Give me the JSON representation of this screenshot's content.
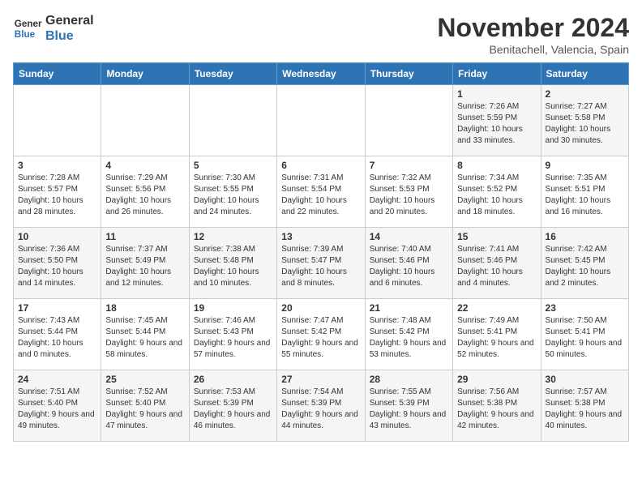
{
  "logo": {
    "line1": "General",
    "line2": "Blue"
  },
  "title": "November 2024",
  "subtitle": "Benitachell, Valencia, Spain",
  "days_of_week": [
    "Sunday",
    "Monday",
    "Tuesday",
    "Wednesday",
    "Thursday",
    "Friday",
    "Saturday"
  ],
  "weeks": [
    [
      {
        "day": "",
        "info": ""
      },
      {
        "day": "",
        "info": ""
      },
      {
        "day": "",
        "info": ""
      },
      {
        "day": "",
        "info": ""
      },
      {
        "day": "",
        "info": ""
      },
      {
        "day": "1",
        "info": "Sunrise: 7:26 AM\nSunset: 5:59 PM\nDaylight: 10 hours and 33 minutes."
      },
      {
        "day": "2",
        "info": "Sunrise: 7:27 AM\nSunset: 5:58 PM\nDaylight: 10 hours and 30 minutes."
      }
    ],
    [
      {
        "day": "3",
        "info": "Sunrise: 7:28 AM\nSunset: 5:57 PM\nDaylight: 10 hours and 28 minutes."
      },
      {
        "day": "4",
        "info": "Sunrise: 7:29 AM\nSunset: 5:56 PM\nDaylight: 10 hours and 26 minutes."
      },
      {
        "day": "5",
        "info": "Sunrise: 7:30 AM\nSunset: 5:55 PM\nDaylight: 10 hours and 24 minutes."
      },
      {
        "day": "6",
        "info": "Sunrise: 7:31 AM\nSunset: 5:54 PM\nDaylight: 10 hours and 22 minutes."
      },
      {
        "day": "7",
        "info": "Sunrise: 7:32 AM\nSunset: 5:53 PM\nDaylight: 10 hours and 20 minutes."
      },
      {
        "day": "8",
        "info": "Sunrise: 7:34 AM\nSunset: 5:52 PM\nDaylight: 10 hours and 18 minutes."
      },
      {
        "day": "9",
        "info": "Sunrise: 7:35 AM\nSunset: 5:51 PM\nDaylight: 10 hours and 16 minutes."
      }
    ],
    [
      {
        "day": "10",
        "info": "Sunrise: 7:36 AM\nSunset: 5:50 PM\nDaylight: 10 hours and 14 minutes."
      },
      {
        "day": "11",
        "info": "Sunrise: 7:37 AM\nSunset: 5:49 PM\nDaylight: 10 hours and 12 minutes."
      },
      {
        "day": "12",
        "info": "Sunrise: 7:38 AM\nSunset: 5:48 PM\nDaylight: 10 hours and 10 minutes."
      },
      {
        "day": "13",
        "info": "Sunrise: 7:39 AM\nSunset: 5:47 PM\nDaylight: 10 hours and 8 minutes."
      },
      {
        "day": "14",
        "info": "Sunrise: 7:40 AM\nSunset: 5:46 PM\nDaylight: 10 hours and 6 minutes."
      },
      {
        "day": "15",
        "info": "Sunrise: 7:41 AM\nSunset: 5:46 PM\nDaylight: 10 hours and 4 minutes."
      },
      {
        "day": "16",
        "info": "Sunrise: 7:42 AM\nSunset: 5:45 PM\nDaylight: 10 hours and 2 minutes."
      }
    ],
    [
      {
        "day": "17",
        "info": "Sunrise: 7:43 AM\nSunset: 5:44 PM\nDaylight: 10 hours and 0 minutes."
      },
      {
        "day": "18",
        "info": "Sunrise: 7:45 AM\nSunset: 5:44 PM\nDaylight: 9 hours and 58 minutes."
      },
      {
        "day": "19",
        "info": "Sunrise: 7:46 AM\nSunset: 5:43 PM\nDaylight: 9 hours and 57 minutes."
      },
      {
        "day": "20",
        "info": "Sunrise: 7:47 AM\nSunset: 5:42 PM\nDaylight: 9 hours and 55 minutes."
      },
      {
        "day": "21",
        "info": "Sunrise: 7:48 AM\nSunset: 5:42 PM\nDaylight: 9 hours and 53 minutes."
      },
      {
        "day": "22",
        "info": "Sunrise: 7:49 AM\nSunset: 5:41 PM\nDaylight: 9 hours and 52 minutes."
      },
      {
        "day": "23",
        "info": "Sunrise: 7:50 AM\nSunset: 5:41 PM\nDaylight: 9 hours and 50 minutes."
      }
    ],
    [
      {
        "day": "24",
        "info": "Sunrise: 7:51 AM\nSunset: 5:40 PM\nDaylight: 9 hours and 49 minutes."
      },
      {
        "day": "25",
        "info": "Sunrise: 7:52 AM\nSunset: 5:40 PM\nDaylight: 9 hours and 47 minutes."
      },
      {
        "day": "26",
        "info": "Sunrise: 7:53 AM\nSunset: 5:39 PM\nDaylight: 9 hours and 46 minutes."
      },
      {
        "day": "27",
        "info": "Sunrise: 7:54 AM\nSunset: 5:39 PM\nDaylight: 9 hours and 44 minutes."
      },
      {
        "day": "28",
        "info": "Sunrise: 7:55 AM\nSunset: 5:39 PM\nDaylight: 9 hours and 43 minutes."
      },
      {
        "day": "29",
        "info": "Sunrise: 7:56 AM\nSunset: 5:38 PM\nDaylight: 9 hours and 42 minutes."
      },
      {
        "day": "30",
        "info": "Sunrise: 7:57 AM\nSunset: 5:38 PM\nDaylight: 9 hours and 40 minutes."
      }
    ]
  ]
}
